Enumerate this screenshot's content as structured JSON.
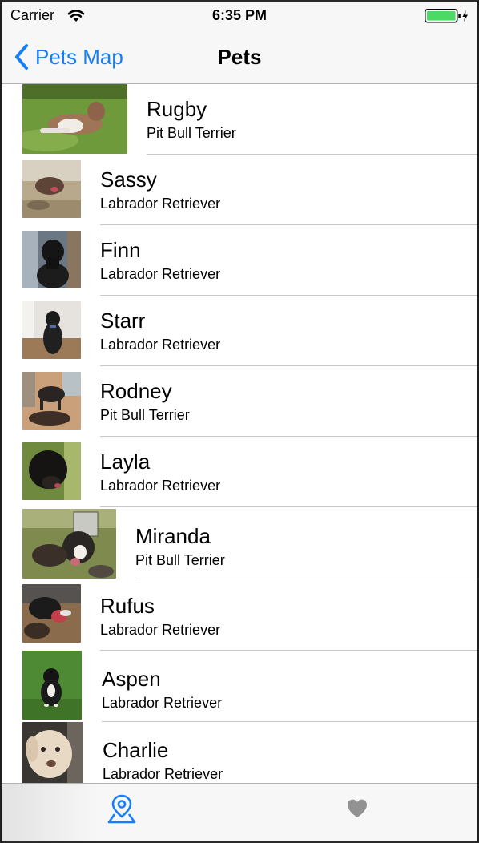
{
  "status_bar": {
    "carrier": "Carrier",
    "time": "6:35 PM",
    "wifi_icon": "wifi-icon",
    "battery_icon": "battery-charging-icon",
    "battery_color": "#4cd964"
  },
  "nav_bar": {
    "back_label": "Pets Map",
    "title": "Pets",
    "accent_color": "#147efb"
  },
  "pets": [
    {
      "name": "Rugby",
      "breed": "Pit Bull Terrier"
    },
    {
      "name": "Sassy",
      "breed": "Labrador Retriever"
    },
    {
      "name": "Finn",
      "breed": "Labrador Retriever"
    },
    {
      "name": "Starr",
      "breed": "Labrador Retriever"
    },
    {
      "name": "Rodney",
      "breed": "Pit Bull Terrier"
    },
    {
      "name": "Layla",
      "breed": "Labrador Retriever"
    },
    {
      "name": "Miranda",
      "breed": "Pit Bull Terrier"
    },
    {
      "name": "Rufus",
      "breed": "Labrador Retriever"
    },
    {
      "name": "Aspen",
      "breed": "Labrador Retriever"
    },
    {
      "name": "Charlie",
      "breed": "Labrador Retriever"
    }
  ],
  "tab_bar": {
    "tabs": [
      {
        "icon": "map-pin-icon",
        "selected": true,
        "color": "#147efb"
      },
      {
        "icon": "heart-icon",
        "selected": false,
        "color": "#929292"
      }
    ]
  }
}
